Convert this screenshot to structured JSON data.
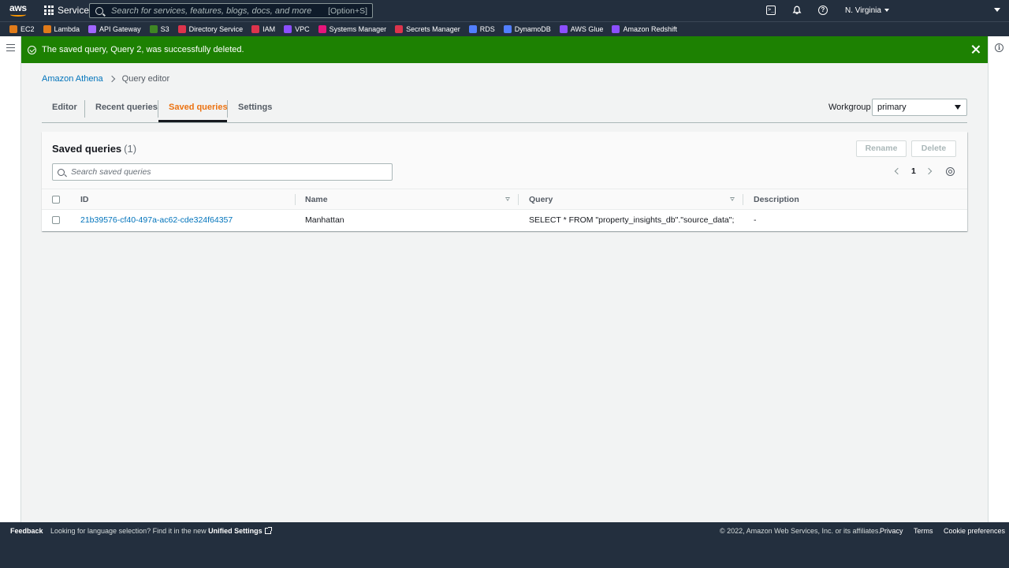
{
  "topnav": {
    "logo_text": "aws",
    "services_label": "Services",
    "search_placeholder": "Search for services, features, blogs, docs, and more",
    "search_shortcut": "[Option+S]",
    "region_label": "N. Virginia"
  },
  "favorites": [
    {
      "label": "EC2",
      "color": "#e07b1a"
    },
    {
      "label": "Lambda",
      "color": "#e07b1a"
    },
    {
      "label": "API Gateway",
      "color": "#a166ff"
    },
    {
      "label": "S3",
      "color": "#3f8624"
    },
    {
      "label": "Directory Service",
      "color": "#dd344c"
    },
    {
      "label": "IAM",
      "color": "#dd344c"
    },
    {
      "label": "VPC",
      "color": "#8c4fff"
    },
    {
      "label": "Systems Manager",
      "color": "#e7157b"
    },
    {
      "label": "Secrets Manager",
      "color": "#dd344c"
    },
    {
      "label": "RDS",
      "color": "#527fff"
    },
    {
      "label": "DynamoDB",
      "color": "#527fff"
    },
    {
      "label": "AWS Glue",
      "color": "#8c4fff"
    },
    {
      "label": "Amazon Redshift",
      "color": "#8c4fff"
    }
  ],
  "flash": {
    "message": "The saved query, Query 2, was successfully deleted.",
    "color": "#1d8102"
  },
  "breadcrumb": {
    "parent": "Amazon Athena",
    "current": "Query editor"
  },
  "tabs": [
    {
      "label": "Editor"
    },
    {
      "label": "Recent queries"
    },
    {
      "label": "Saved queries",
      "active": true
    },
    {
      "label": "Settings"
    }
  ],
  "workgroup": {
    "label": "Workgroup",
    "value": "primary"
  },
  "panel": {
    "title": "Saved queries",
    "count": "(1)",
    "rename_label": "Rename",
    "delete_label": "Delete",
    "filter_placeholder": "Search saved queries",
    "page": "1"
  },
  "table": {
    "columns": [
      "ID",
      "Name",
      "Query",
      "Description"
    ],
    "rows": [
      {
        "id": "21b39576-cf40-497a-ac62-cde324f64357",
        "name": "Manhattan",
        "query": "SELECT * FROM \"property_insights_db\".\"source_data\";",
        "description": "-"
      }
    ]
  },
  "footer": {
    "feedback": "Feedback",
    "lang_message": "Looking for language selection? Find it in the new ",
    "unified_settings": "Unified Settings",
    "copyright": "© 2022, Amazon Web Services, Inc. or its affiliates.",
    "privacy": "Privacy",
    "terms": "Terms",
    "cookie": "Cookie preferences"
  },
  "colors": {
    "accent_active_tab": "#ec7211",
    "link": "#0073bb",
    "nav_bg": "#232f3e"
  }
}
